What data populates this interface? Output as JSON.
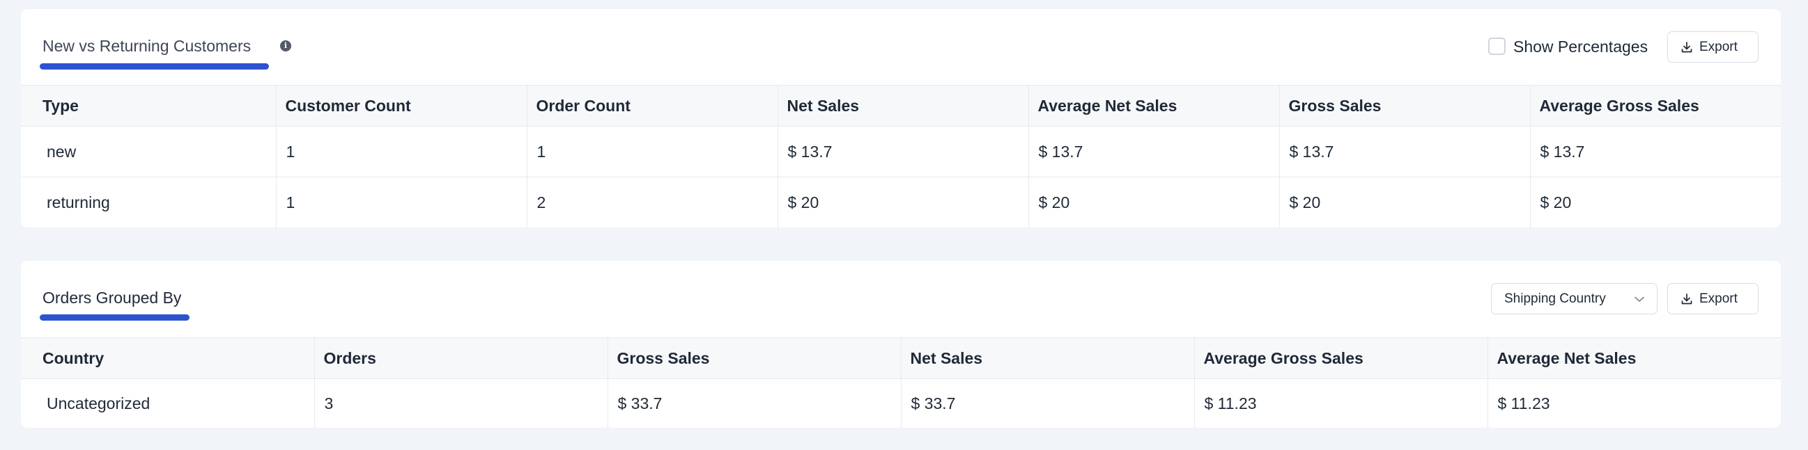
{
  "customers_card": {
    "title": "New vs Returning Customers",
    "info_icon": "info-icon",
    "show_percentages_label": "Show Percentages",
    "show_percentages_checked": false,
    "export_label": "Export",
    "columns": [
      "Type",
      "Customer Count",
      "Order Count",
      "Net Sales",
      "Average Net Sales",
      "Gross Sales",
      "Average Gross Sales"
    ],
    "rows": [
      [
        "new",
        "1",
        "1",
        "$ 13.7",
        "$ 13.7",
        "$ 13.7",
        "$ 13.7"
      ],
      [
        "returning",
        "1",
        "2",
        "$ 20",
        "$ 20",
        "$ 20",
        "$ 20"
      ]
    ]
  },
  "orders_card": {
    "title": "Orders Grouped By",
    "group_by_selected": "Shipping Country",
    "export_label": "Export",
    "columns": [
      "Country",
      "Orders",
      "Gross Sales",
      "Net Sales",
      "Average Gross Sales",
      "Average Net Sales"
    ],
    "rows": [
      [
        "Uncategorized",
        "3",
        "$ 33.7",
        "$ 33.7",
        "$ 11.23",
        "$ 11.23"
      ]
    ]
  },
  "colors": {
    "accent": "#2c53d0",
    "page_background": "#f1f4f9",
    "header_row": "#f7f8fa"
  }
}
